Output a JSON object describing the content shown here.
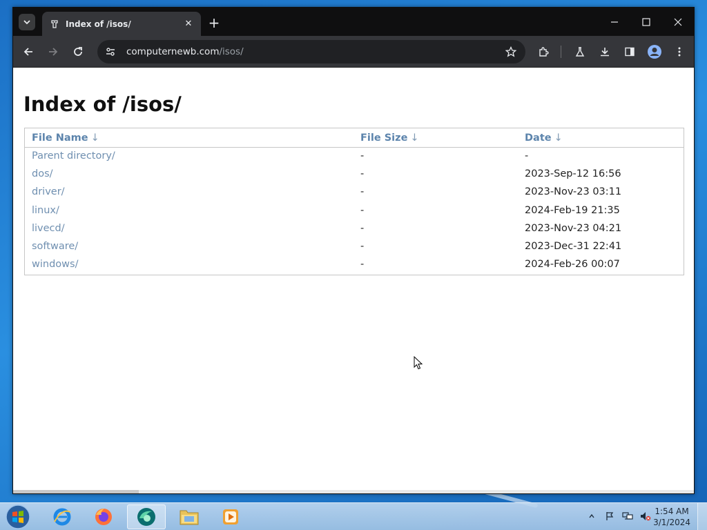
{
  "browser": {
    "tab": {
      "title": "Index of /isos/"
    },
    "omnibox": {
      "host": "computernewb.com",
      "path": "/isos/"
    }
  },
  "page": {
    "heading": "Index of /isos/",
    "columns": {
      "name": "File Name",
      "size": "File Size",
      "date": "Date",
      "sort_arrow": "↓"
    },
    "rows": [
      {
        "name": "Parent directory/",
        "size": "-",
        "date": "-"
      },
      {
        "name": "dos/",
        "size": "-",
        "date": "2023-Sep-12 16:56"
      },
      {
        "name": "driver/",
        "size": "-",
        "date": "2023-Nov-23 03:11"
      },
      {
        "name": "linux/",
        "size": "-",
        "date": "2024-Feb-19 21:35"
      },
      {
        "name": "livecd/",
        "size": "-",
        "date": "2023-Nov-23 04:21"
      },
      {
        "name": "software/",
        "size": "-",
        "date": "2023-Dec-31 22:41"
      },
      {
        "name": "windows/",
        "size": "-",
        "date": "2024-Feb-26 00:07"
      }
    ]
  },
  "taskbar": {
    "apps": [
      "internet-explorer-icon",
      "firefox-icon",
      "browser-icon",
      "file-explorer-icon",
      "media-player-icon"
    ],
    "clock": {
      "time": "1:54 AM",
      "date": "3/1/2024"
    }
  },
  "colors": {
    "link": "#6f8fb0",
    "header_link": "#5c84ac",
    "tabstrip": "#0f0f10",
    "toolbar": "#35363a"
  }
}
